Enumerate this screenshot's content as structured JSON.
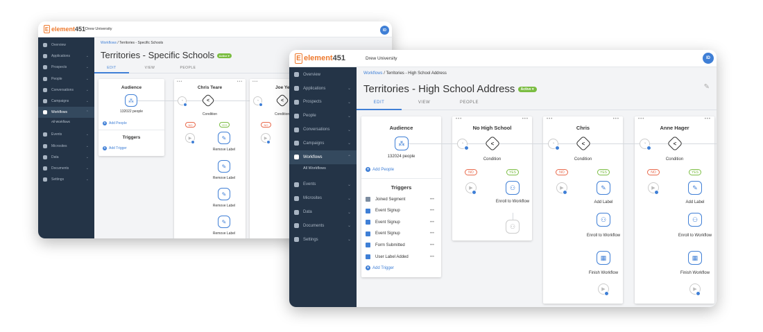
{
  "brand": {
    "name": "element",
    "number": "451",
    "letter": "E",
    "accent": "#ee7a2e",
    "primary": "#3f7fd6",
    "success": "#7bbd42",
    "danger": "#e8684a",
    "sidebar_bg": "#243447"
  },
  "back": {
    "org": "Drew University",
    "avatar": "ID",
    "nav": [
      {
        "label": "Overview",
        "icon": "grid-icon",
        "chev": ""
      },
      {
        "label": "Applications",
        "icon": "document-icon",
        "chev": "⌄"
      },
      {
        "label": "Prospects",
        "icon": "users-icon",
        "chev": "⌄"
      },
      {
        "label": "People",
        "icon": "person-icon",
        "chev": "⌄"
      },
      {
        "label": "Conversations",
        "icon": "chat-icon",
        "chev": "⌄"
      },
      {
        "label": "Campaigns",
        "icon": "megaphone-icon",
        "chev": "⌄"
      },
      {
        "label": "Workflows",
        "icon": "workflow-icon",
        "chev": "⌃"
      },
      {
        "label": "Events",
        "icon": "calendar-icon",
        "chev": "⌄"
      },
      {
        "label": "Microsites",
        "icon": "monitor-icon",
        "chev": "⌄"
      },
      {
        "label": "Data",
        "icon": "cloud-icon",
        "chev": "⌄"
      },
      {
        "label": "Documents",
        "icon": "folder-icon",
        "chev": "⌄"
      },
      {
        "label": "Settings",
        "icon": "settings-icon",
        "chev": "⌄"
      }
    ],
    "sub": "All Workflows",
    "crumb_link": "Workflows",
    "crumb_sep": "/",
    "crumb_current": "Territories - Specific Schools",
    "title": "Territories - Specific Schools",
    "badge": "Active ▾",
    "tabs": [
      "EDIT",
      "VIEW",
      "PEOPLE"
    ],
    "audience": {
      "title": "Audience",
      "count": "132022 people",
      "add_people": "Add People",
      "triggers_title": "Triggers",
      "add_trigger": "Add Trigger"
    },
    "step1": {
      "title": "Chris Teare",
      "condition": "Condition",
      "no": "NO",
      "yes": "YES",
      "actions": [
        "Remove Label",
        "Remove Label",
        "Remove Label",
        "Remove Label"
      ]
    },
    "step2": {
      "title": "Joe Yec",
      "condition": "Condition",
      "no": "NO"
    }
  },
  "front": {
    "org": "Drew University",
    "avatar": "ID",
    "nav": [
      {
        "label": "Overview",
        "icon": "grid-icon",
        "chev": ""
      },
      {
        "label": "Applications",
        "icon": "document-icon",
        "chev": "⌄"
      },
      {
        "label": "Prospects",
        "icon": "users-icon",
        "chev": "⌄"
      },
      {
        "label": "People",
        "icon": "person-icon",
        "chev": "⌄"
      },
      {
        "label": "Conversations",
        "icon": "chat-icon",
        "chev": "⌄"
      },
      {
        "label": "Campaigns",
        "icon": "megaphone-icon",
        "chev": "⌄"
      },
      {
        "label": "Workflows",
        "icon": "workflow-icon",
        "chev": "⌃"
      },
      {
        "label": "Events",
        "icon": "calendar-icon",
        "chev": "⌄"
      },
      {
        "label": "Microsites",
        "icon": "monitor-icon",
        "chev": "⌄"
      },
      {
        "label": "Data",
        "icon": "cloud-icon",
        "chev": "⌄"
      },
      {
        "label": "Documents",
        "icon": "folder-icon",
        "chev": "⌄"
      },
      {
        "label": "Settings",
        "icon": "settings-icon",
        "chev": "⌄"
      }
    ],
    "sub": "All Workflows",
    "crumb_link": "Workflows",
    "crumb_sep": "/",
    "crumb_current": "Territories - High School Address",
    "title": "Territories - High School Address",
    "badge": "Active ▾",
    "tabs": [
      "EDIT",
      "VIEW",
      "PEOPLE"
    ],
    "audience": {
      "title": "Audience",
      "count": "132024 people",
      "add_people": "Add People",
      "triggers_title": "Triggers",
      "add_trigger": "Add Trigger",
      "triggers": [
        {
          "label": "Joined Segment",
          "color": "#7d8da0"
        },
        {
          "label": "Event Signup",
          "color": "#3f7fd6"
        },
        {
          "label": "Event Signup",
          "color": "#3f7fd6"
        },
        {
          "label": "Event Signup",
          "color": "#3f7fd6"
        },
        {
          "label": "Form Submitted",
          "color": "#3f7fd6"
        },
        {
          "label": "User Label Added",
          "color": "#3f7fd6"
        }
      ],
      "dots": "•••"
    },
    "steps": [
      {
        "title": "No High School",
        "condition": "Condition",
        "no": "NO",
        "yes": "YES",
        "action1": "Enroll to Workflow"
      },
      {
        "title": "Chris",
        "condition": "Condition",
        "no": "NO",
        "yes": "YES",
        "action1": "Add Label",
        "action2": "Enroll to Workflow",
        "action3": "Finish Workflow"
      },
      {
        "title": "Anne Hager",
        "condition": "Condition",
        "no": "NO",
        "yes": "YES",
        "action1": "Add Label",
        "action2": "Enroll to Workflow",
        "action3": "Finish Workflow"
      }
    ]
  }
}
